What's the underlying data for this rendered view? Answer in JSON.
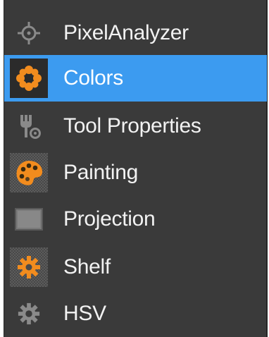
{
  "menu": {
    "items": [
      {
        "label": "PixelAnalyzer",
        "icon": "crosshair-icon",
        "selected": false
      },
      {
        "label": "Colors",
        "icon": "color-burst-icon",
        "selected": true
      },
      {
        "label": "Tool Properties",
        "icon": "tool-properties-icon",
        "selected": false
      },
      {
        "label": "Painting",
        "icon": "palette-icon",
        "selected": false
      },
      {
        "label": "Projection",
        "icon": "projection-icon",
        "selected": false
      },
      {
        "label": "Shelf",
        "icon": "shelf-gear-icon",
        "selected": false
      },
      {
        "label": "HSV",
        "icon": "hsv-gear-icon",
        "selected": false
      }
    ]
  },
  "colors": {
    "panel_bg": "#3a3a3a",
    "selected_bg": "#3c9bf0",
    "text": "#f2f2f2",
    "icon_grey": "#8a8a8a",
    "icon_orange": "#f28c1e"
  }
}
